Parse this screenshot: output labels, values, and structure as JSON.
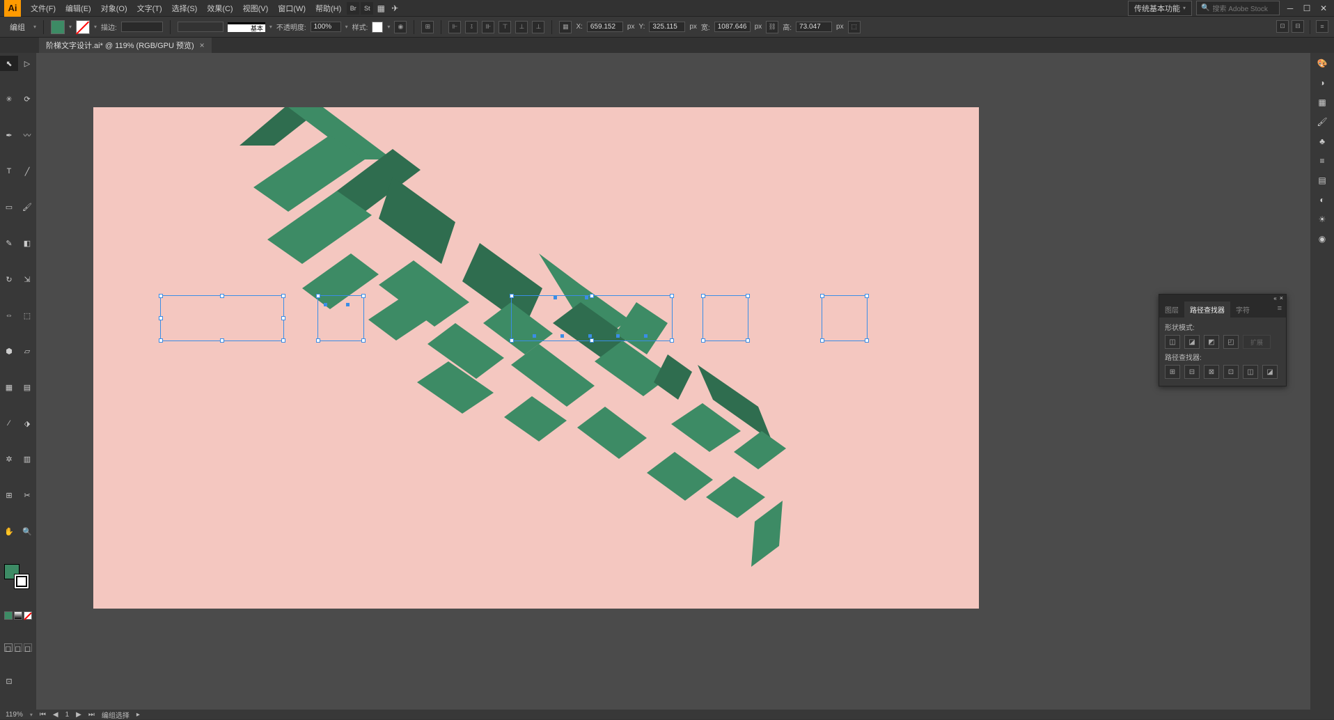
{
  "app": {
    "logo": "Ai"
  },
  "menu": [
    "文件(F)",
    "编辑(E)",
    "对象(O)",
    "文字(T)",
    "选择(S)",
    "效果(C)",
    "视图(V)",
    "窗口(W)",
    "帮助(H)"
  ],
  "workspace": "传统基本功能",
  "search_placeholder": "搜索 Adobe Stock",
  "control": {
    "context": "编组",
    "stroke_label": "描边:",
    "stroke_line": "基本",
    "opacity_label": "不透明度:",
    "opacity_val": "100%",
    "style_label": "样式:",
    "X_label": "X:",
    "X_val": "659.152",
    "Y_label": "Y:",
    "Y_val": "325.115",
    "W_label": "宽:",
    "W_val": "1087.646",
    "H_label": "高:",
    "H_val": "73.047",
    "unit": "px"
  },
  "doc_tab": "阶梯文字设计.ai* @ 119% (RGB/GPU 预览)",
  "status": {
    "zoom": "119%",
    "artboard": "1",
    "tool": "编组选择"
  },
  "pathfinder": {
    "tabs": [
      "图层",
      "路径查找器",
      "字符"
    ],
    "shape_modes_label": "形状模式:",
    "pathfinders_label": "路径查找器:",
    "expand_label": "扩展"
  },
  "colors": {
    "fill": "#3d8b65",
    "artboard": "#f4c7c0"
  }
}
